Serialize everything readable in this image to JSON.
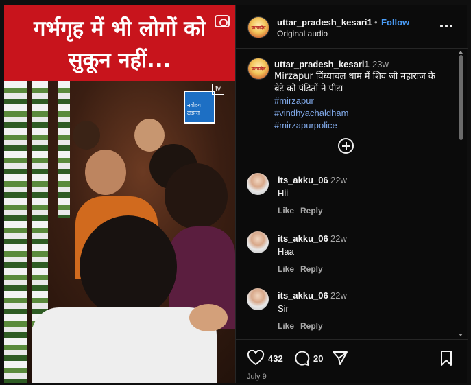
{
  "post": {
    "banner_line1": "गर्भगृह में भी लोगों को",
    "banner_line2": "सुकून नहीं...",
    "channel_logo_text": "नवोदय टाइम्स",
    "tv_mark": "tv"
  },
  "header": {
    "username": "uttar_pradesh_kesari1",
    "separator": "•",
    "follow_label": "Follow",
    "audio": "Original audio",
    "avatar_text": "उत्तरप्रदेश"
  },
  "caption": {
    "username": "uttar_pradesh_kesari1",
    "time": "23w",
    "text": "Mirzapur विंध्याचल धाम में शिव जी महाराज के बेटे को पंडितों ने पीटा",
    "tags": [
      "#mirzapur",
      "#vindhyachaldham",
      "#mirzapurpolice"
    ]
  },
  "comments": [
    {
      "username": "its_akku_06",
      "time": "22w",
      "text": "Hii",
      "like": "Like",
      "reply": "Reply"
    },
    {
      "username": "its_akku_06",
      "time": "22w",
      "text": "Haa",
      "like": "Like",
      "reply": "Reply"
    },
    {
      "username": "its_akku_06",
      "time": "22w",
      "text": "Sir",
      "like": "Like",
      "reply": "Reply"
    }
  ],
  "actions": {
    "likes": "432",
    "comments": "20",
    "date": "July 9"
  },
  "icons": {
    "heart": "heart-icon",
    "comment": "comment-icon",
    "share": "share-icon",
    "save": "bookmark-icon",
    "more": "more-icon",
    "add": "add-comment-icon",
    "camera": "camera-icon"
  },
  "colors": {
    "banner_red": "#c8141c",
    "follow_blue": "#4a9df8",
    "hashtag": "#7fa7e6",
    "background": "#0b0b0b"
  }
}
